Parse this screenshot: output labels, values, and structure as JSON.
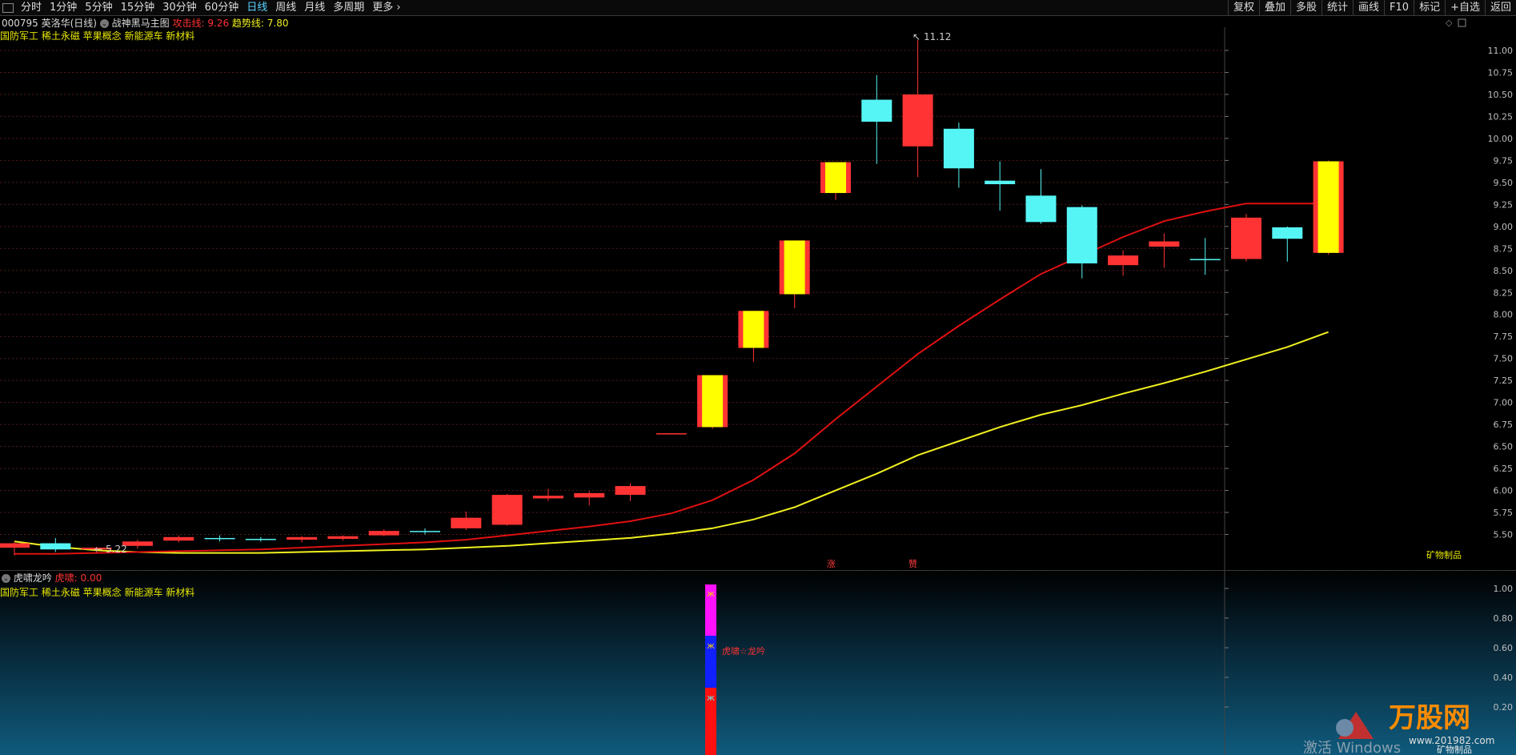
{
  "toolbar": {
    "periods": [
      "分时",
      "1分钟",
      "5分钟",
      "15分钟",
      "30分钟",
      "60分钟",
      "日线",
      "周线",
      "月线",
      "多周期",
      "更多"
    ],
    "active_period": "日线",
    "actions": [
      "复权",
      "叠加",
      "多股",
      "统计",
      "画线",
      "F10",
      "标记",
      "+自选",
      "返回"
    ]
  },
  "main_panel": {
    "stock_code_name": "000795 英洛华(日线)",
    "indicator_name": "战神黑马主图",
    "attack_line_label": "攻击线: 9.26",
    "trend_line_label": "趋势线: 7.80",
    "concepts": "国防军工 稀土永磁 苹果概念 新能源车 新材料",
    "high_marker": "11.12",
    "low_marker": "5.22",
    "bottom_tags": [
      "涨",
      "赞"
    ],
    "credit": "矿物制品",
    "y_ticks": [
      "11.00",
      "10.75",
      "10.50",
      "10.25",
      "10.00",
      "9.75",
      "9.50",
      "9.25",
      "9.00",
      "8.75",
      "8.50",
      "8.25",
      "8.00",
      "7.75",
      "7.50",
      "7.25",
      "7.00",
      "6.75",
      "6.50",
      "6.25",
      "6.00",
      "5.75",
      "5.50"
    ]
  },
  "sub_panel": {
    "indicator_name": "虎啸龙吟",
    "value_label": "虎啸: 0.00",
    "concepts": "国防军工 稀土永磁 苹果概念 新能源车 新材料",
    "signal_label": "虎啸☆龙吟",
    "y_ticks": [
      "1.00",
      "0.80",
      "0.60",
      "0.40",
      "0.20"
    ],
    "credit": "矿物制品"
  },
  "watermark": {
    "logo_text": "万股网",
    "url": "www.201982.com",
    "activate": "激活 Windows"
  },
  "colors": {
    "up": "#ff3333",
    "down": "#55f5f5",
    "attack_line": "#e01010",
    "trend_line": "#f0f020",
    "yellow_text": "#e8e800",
    "grid": "#5a1a1a",
    "axis_text": "#bdbdbd"
  },
  "chart_data": {
    "type": "candlestick",
    "title": "战神黑马主图",
    "ylim": [
      5.22,
      11.12
    ],
    "candles": [
      {
        "o": 5.35,
        "h": 5.42,
        "l": 5.26,
        "c": 5.4
      },
      {
        "o": 5.4,
        "h": 5.46,
        "l": 5.3,
        "c": 5.33
      },
      {
        "o": 5.33,
        "h": 5.36,
        "l": 5.29,
        "c": 5.35
      },
      {
        "o": 5.37,
        "h": 5.44,
        "l": 5.34,
        "c": 5.42
      },
      {
        "o": 5.43,
        "h": 5.49,
        "l": 5.41,
        "c": 5.47
      },
      {
        "o": 5.46,
        "h": 5.49,
        "l": 5.42,
        "c": 5.45
      },
      {
        "o": 5.45,
        "h": 5.47,
        "l": 5.42,
        "c": 5.44
      },
      {
        "o": 5.44,
        "h": 5.48,
        "l": 5.41,
        "c": 5.47
      },
      {
        "o": 5.45,
        "h": 5.49,
        "l": 5.43,
        "c": 5.48
      },
      {
        "o": 5.49,
        "h": 5.56,
        "l": 5.48,
        "c": 5.54
      },
      {
        "o": 5.54,
        "h": 5.57,
        "l": 5.5,
        "c": 5.53
      },
      {
        "o": 5.57,
        "h": 5.76,
        "l": 5.55,
        "c": 5.69
      },
      {
        "o": 5.61,
        "h": 5.96,
        "l": 5.6,
        "c": 5.95
      },
      {
        "o": 5.91,
        "h": 6.02,
        "l": 5.88,
        "c": 5.94
      },
      {
        "o": 5.92,
        "h": 5.99,
        "l": 5.83,
        "c": 5.97
      },
      {
        "o": 5.95,
        "h": 6.08,
        "l": 5.88,
        "c": 6.05
      },
      {
        "o": 6.64,
        "h": 6.65,
        "l": 6.64,
        "c": 6.65
      },
      {
        "o": 6.72,
        "h": 7.31,
        "l": 6.7,
        "c": 7.31
      },
      {
        "o": 7.62,
        "h": 8.04,
        "l": 7.46,
        "c": 8.04
      },
      {
        "o": 8.23,
        "h": 8.84,
        "l": 8.07,
        "c": 8.84
      },
      {
        "o": 9.38,
        "h": 9.73,
        "l": 9.3,
        "c": 9.73
      },
      {
        "o": 10.44,
        "h": 10.72,
        "l": 9.71,
        "c": 10.19
      },
      {
        "o": 9.91,
        "h": 11.12,
        "l": 9.56,
        "c": 10.5
      },
      {
        "o": 10.11,
        "h": 10.18,
        "l": 9.44,
        "c": 9.66
      },
      {
        "o": 9.52,
        "h": 9.74,
        "l": 9.18,
        "c": 9.48
      },
      {
        "o": 9.35,
        "h": 9.65,
        "l": 9.03,
        "c": 9.05
      },
      {
        "o": 9.22,
        "h": 9.24,
        "l": 8.41,
        "c": 8.58
      },
      {
        "o": 8.56,
        "h": 8.73,
        "l": 8.44,
        "c": 8.67
      },
      {
        "o": 8.77,
        "h": 8.92,
        "l": 8.53,
        "c": 8.83
      },
      {
        "o": 8.63,
        "h": 8.87,
        "l": 8.45,
        "c": 8.62
      },
      {
        "o": 8.63,
        "h": 9.14,
        "l": 8.6,
        "c": 9.1
      },
      {
        "o": 8.99,
        "h": 9.0,
        "l": 8.6,
        "c": 8.86
      },
      {
        "o": 8.7,
        "h": 9.75,
        "l": 8.68,
        "c": 9.74
      }
    ],
    "yellow_body_indices": [
      17,
      18,
      19,
      20,
      32
    ],
    "attack_line": [
      5.28,
      5.28,
      5.29,
      5.3,
      5.31,
      5.32,
      5.33,
      5.35,
      5.37,
      5.39,
      5.41,
      5.44,
      5.49,
      5.54,
      5.59,
      5.65,
      5.74,
      5.89,
      6.12,
      6.42,
      6.81,
      7.18,
      7.55,
      7.87,
      8.17,
      8.46,
      8.67,
      8.88,
      9.06,
      9.17,
      9.26,
      9.26,
      9.26
    ],
    "trend_line": [
      5.42,
      5.36,
      5.32,
      5.3,
      5.29,
      5.29,
      5.29,
      5.3,
      5.31,
      5.32,
      5.33,
      5.35,
      5.37,
      5.4,
      5.43,
      5.46,
      5.51,
      5.57,
      5.67,
      5.81,
      6.0,
      6.19,
      6.4,
      6.56,
      6.72,
      6.86,
      6.97,
      7.1,
      7.22,
      7.35,
      7.49,
      7.63,
      7.8
    ]
  }
}
